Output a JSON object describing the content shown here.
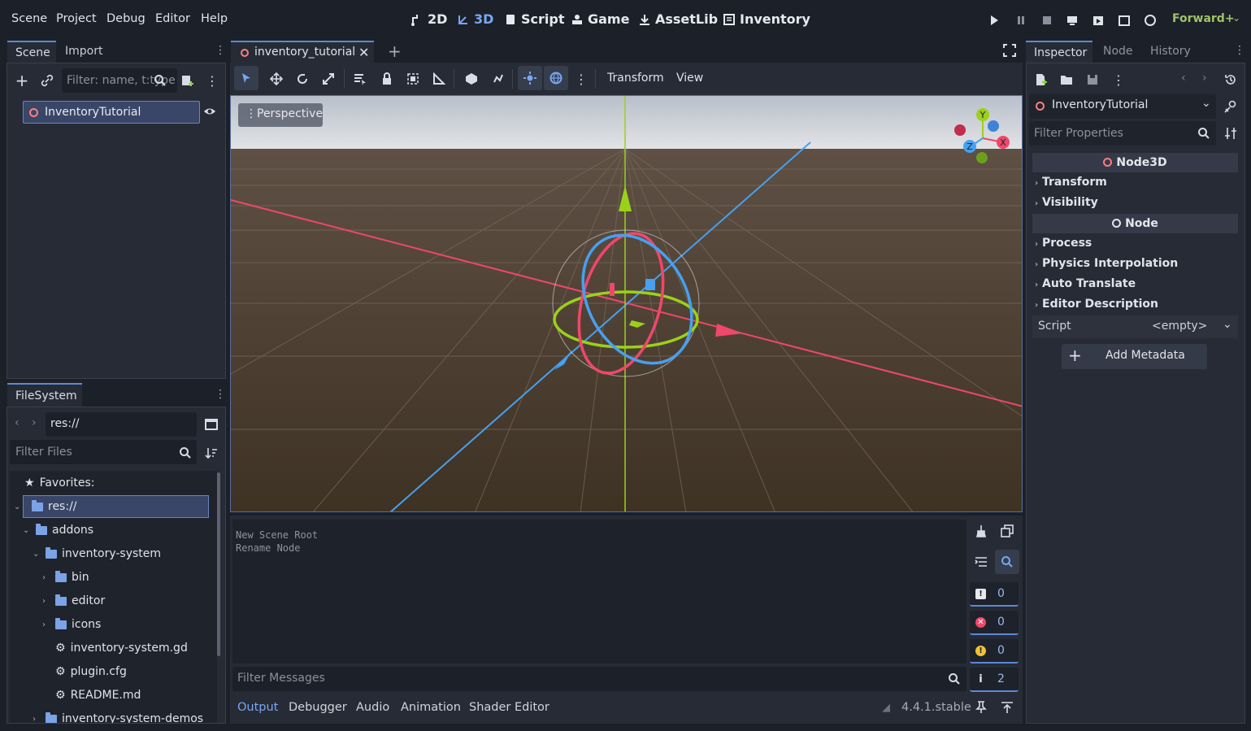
{
  "menu": [
    "Scene",
    "Project",
    "Debug",
    "Editor",
    "Help"
  ],
  "workspaces": [
    {
      "label": "2D",
      "icon": "2d-icon"
    },
    {
      "label": "3D",
      "icon": "3d-icon"
    },
    {
      "label": "Script",
      "icon": "script-icon"
    },
    {
      "label": "Game",
      "icon": "game-icon"
    },
    {
      "label": "AssetLib",
      "icon": "assetlib-icon"
    },
    {
      "label": "Inventory",
      "icon": "inventory-icon"
    }
  ],
  "renderer": "Forward+",
  "scene_dock": {
    "tabs": [
      "Scene",
      "Import"
    ],
    "filter_placeholder": "Filter: name, t:type",
    "root_node": "InventoryTutorial"
  },
  "filesystem": {
    "tab": "FileSystem",
    "path": "res://",
    "filter_placeholder": "Filter Files",
    "favorites": "Favorites:",
    "items": [
      {
        "label": "res://",
        "depth": 0,
        "kind": "folder",
        "open": true,
        "selected": true
      },
      {
        "label": "addons",
        "depth": 1,
        "kind": "folder",
        "open": true
      },
      {
        "label": "inventory-system",
        "depth": 2,
        "kind": "folder",
        "open": true
      },
      {
        "label": "bin",
        "depth": 3,
        "kind": "folder",
        "open": false
      },
      {
        "label": "editor",
        "depth": 3,
        "kind": "folder",
        "open": false
      },
      {
        "label": "icons",
        "depth": 3,
        "kind": "folder",
        "open": false
      },
      {
        "label": "inventory-system.gd",
        "depth": 3,
        "kind": "gear"
      },
      {
        "label": "plugin.cfg",
        "depth": 3,
        "kind": "gear"
      },
      {
        "label": "README.md",
        "depth": 3,
        "kind": "gear"
      },
      {
        "label": "inventory-system-demos",
        "depth": 2,
        "kind": "folder",
        "open": false
      }
    ]
  },
  "editor": {
    "tab": "inventory_tutorial",
    "toolbar_menus": [
      "Transform",
      "View"
    ],
    "viewport_label": "Perspective",
    "gizmo_axes": [
      "Y",
      "X",
      "Z"
    ]
  },
  "output": {
    "lines": [
      "New Scene Root",
      "Rename Node"
    ],
    "filter_placeholder": "Filter Messages",
    "counters": [
      0,
      0,
      0,
      2
    ],
    "tabs": [
      "Output",
      "Debugger",
      "Audio",
      "Animation",
      "Shader Editor"
    ],
    "version": "4.4.1.stable"
  },
  "inspector": {
    "tabs": [
      "Inspector",
      "Node",
      "History"
    ],
    "node": "InventoryTutorial",
    "filter_placeholder": "Filter Properties",
    "cat1": "Node3D",
    "cat2": "Node",
    "groups1": [
      "Transform",
      "Visibility"
    ],
    "groups2": [
      "Process",
      "Physics Interpolation",
      "Auto Translate",
      "Editor Description"
    ],
    "script_label": "Script",
    "script_value": "<empty>",
    "add_metadata": "Add Metadata"
  }
}
